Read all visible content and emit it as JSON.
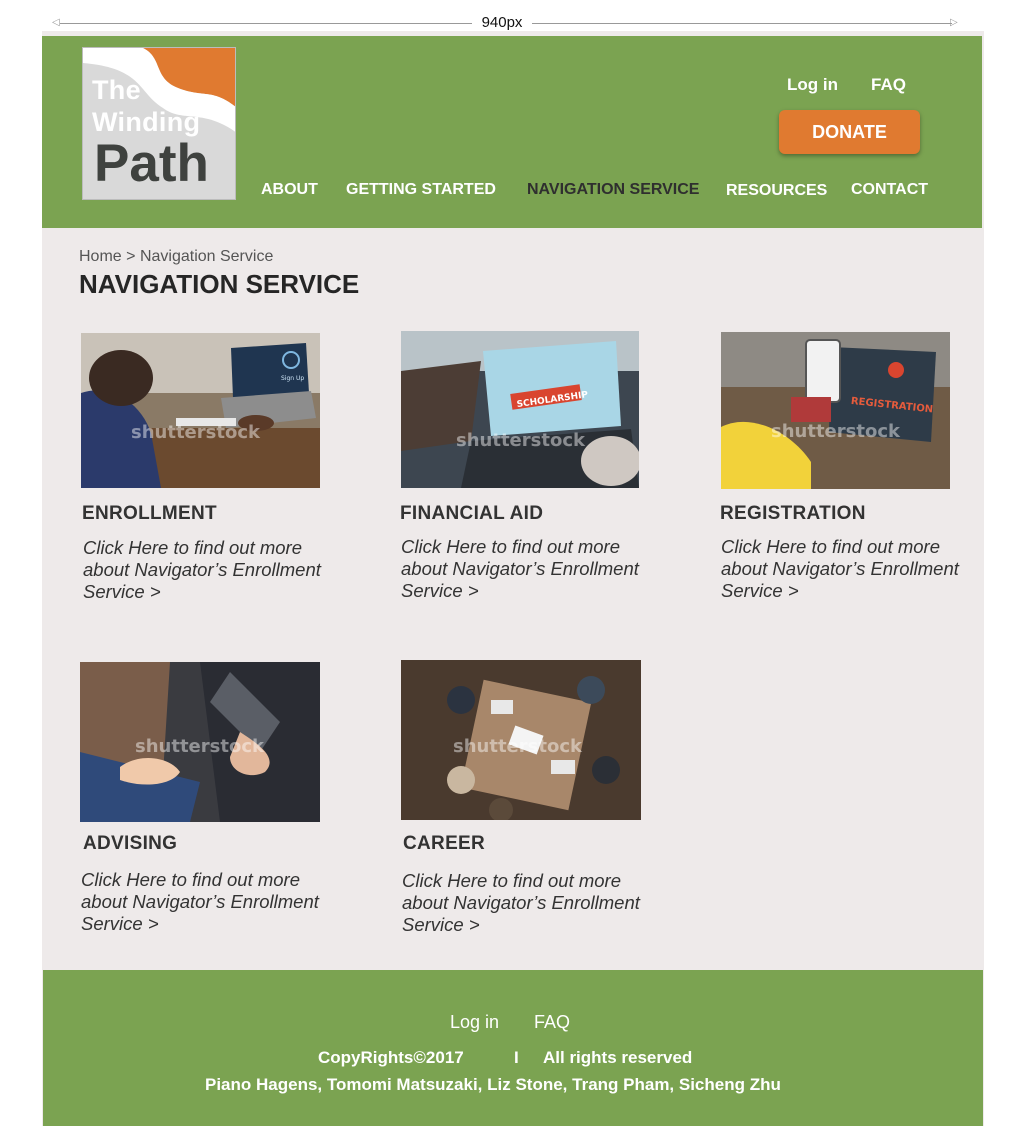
{
  "annotation": {
    "width_label": "940px"
  },
  "logo": {
    "line1": "The",
    "line2": "Winding",
    "line3": "Path"
  },
  "utility_nav": {
    "login": "Log in",
    "faq": "FAQ",
    "donate": "DONATE"
  },
  "main_nav": [
    {
      "label": "ABOUT"
    },
    {
      "label": "GETTING STARTED"
    },
    {
      "label": "NAVIGATION SERVICE",
      "active": true
    },
    {
      "label": "RESOURCES"
    },
    {
      "label": "CONTACT"
    }
  ],
  "breadcrumb": {
    "home": "Home",
    "separator": ">",
    "current": "Navigation Service"
  },
  "page_title": "NAVIGATION SERVICE",
  "cards": [
    {
      "title": "ENROLLMENT",
      "description": "Click Here to find out more about Navigator’s Enrollment Service >",
      "image": "laptop-signup-photo",
      "watermark": "shutterstock",
      "screen_text": "Sign Up"
    },
    {
      "title": "FINANCIAL AID",
      "description": "Click Here to find out more about Navigator’s Enrollment Service >",
      "image": "laptop-scholarship-photo",
      "watermark": "shutterstock",
      "screen_text": "SCHOLARSHIP"
    },
    {
      "title": "REGISTRATION",
      "description": "Click Here to find out more about Navigator’s Enrollment Service >",
      "image": "laptop-registration-photo",
      "watermark": "shutterstock",
      "screen_text": "REGISTRATION"
    },
    {
      "title": "ADVISING",
      "description": "Click Here to find out more about Navigator’s Enrollment Service >",
      "image": "advising-hands-photo",
      "watermark": "shutterstock"
    },
    {
      "title": "CAREER",
      "description": "Click Here to find out more about Navigator’s Enrollment Service >",
      "image": "team-meeting-photo",
      "watermark": "shutterstock"
    }
  ],
  "footer": {
    "login": "Log in",
    "faq": "FAQ",
    "copyright": "CopyRights©2017",
    "divider": "I",
    "rights": "All rights reserved",
    "authors": "Piano Hagens, Tomomi Matsuzaki, Liz Stone, Trang Pham, Sicheng Zhu"
  },
  "colors": {
    "brand_green": "#7ba351",
    "accent_orange": "#e07a30",
    "content_bg": "#eeeaea"
  }
}
